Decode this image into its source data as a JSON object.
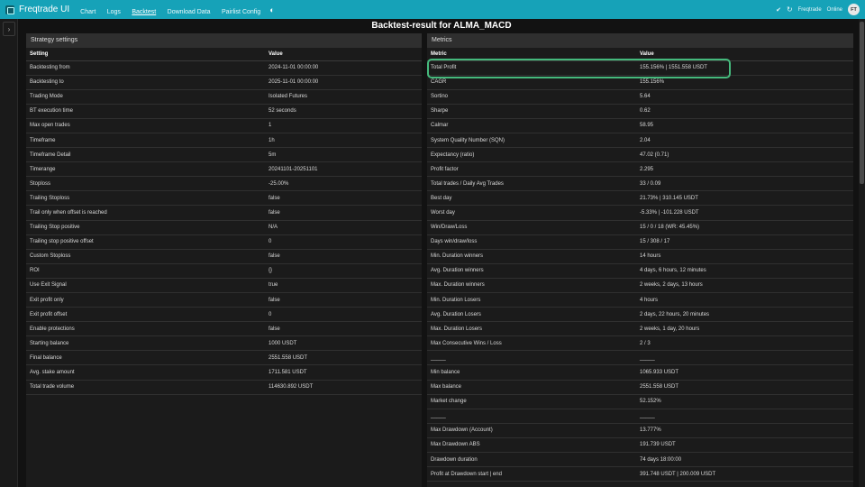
{
  "topbar": {
    "brand": "Freqtrade UI",
    "nav": [
      "Chart",
      "Logs",
      "Backtest",
      "Download Data",
      "Pairlist Config"
    ],
    "active_nav": "Backtest",
    "bot_name": "Freqtrade",
    "status": "Online",
    "avatar": "FT"
  },
  "page": {
    "title": "Backtest-result for ALMA_MACD"
  },
  "strategy": {
    "header": "Strategy settings",
    "col_setting": "Setting",
    "col_value": "Value",
    "rows": [
      [
        "Backtesting from",
        "2024-11-01 00:00:00"
      ],
      [
        "Backtesting to",
        "2025-11-01 00:00:00"
      ],
      [
        "Trading Mode",
        "Isolated Futures"
      ],
      [
        "BT execution time",
        "52 seconds"
      ],
      [
        "Max open trades",
        "1"
      ],
      [
        "Timeframe",
        "1h"
      ],
      [
        "Timeframe Detail",
        "5m"
      ],
      [
        "Timerange",
        "20241101-20251101"
      ],
      [
        "Stoploss",
        "-25.00%"
      ],
      [
        "Trailing Stoploss",
        "false"
      ],
      [
        "Trail only when offset is reached",
        "false"
      ],
      [
        "Trailing Stop positive",
        "N/A"
      ],
      [
        "Trailing stop positive offset",
        "0"
      ],
      [
        "Custom Stoploss",
        "false"
      ],
      [
        "ROI",
        "{}"
      ],
      [
        "Use Exit Signal",
        "true"
      ],
      [
        "Exit profit only",
        "false"
      ],
      [
        "Exit profit offset",
        "0"
      ],
      [
        "Enable protections",
        "false"
      ],
      [
        "Starting balance",
        "1000 USDT"
      ],
      [
        "Final balance",
        "2551.558 USDT"
      ],
      [
        "Avg. stake amount",
        "1711.581 USDT"
      ],
      [
        "Total trade volume",
        "114630.892 USDT"
      ]
    ]
  },
  "metrics": {
    "header": "Metrics",
    "col_metric": "Metric",
    "col_value": "Value",
    "rows": [
      [
        "Total Profit",
        "155.156% | 1551.558 USDT"
      ],
      [
        "CAGR",
        "155.156%"
      ],
      [
        "Sortino",
        "5.64"
      ],
      [
        "Sharpe",
        "0.62"
      ],
      [
        "Calmar",
        "58.95"
      ],
      [
        "System Quality Number (SQN)",
        "2.04"
      ],
      [
        "Expectancy (ratio)",
        "47.02 (0.71)"
      ],
      [
        "Profit factor",
        "2.295"
      ],
      [
        "Total trades / Daily Avg Trades",
        "33 / 0.09"
      ],
      [
        "Best day",
        "21.73% | 310.145 USDT"
      ],
      [
        "Worst day",
        "-5.33% | -101.228 USDT"
      ],
      [
        "Win/Draw/Loss",
        "15 / 0 / 18 (WR: 45.45%)"
      ],
      [
        "Days win/draw/loss",
        "15 / 308 / 17"
      ],
      [
        "Min. Duration winners",
        "14 hours"
      ],
      [
        "Avg. Duration winners",
        "4 days, 6 hours, 12 minutes"
      ],
      [
        "Max. Duration winners",
        "2 weeks, 2 days, 13 hours"
      ],
      [
        "Min. Duration Losers",
        "4 hours"
      ],
      [
        "Avg. Duration Losers",
        "2 days, 22 hours, 20 minutes"
      ],
      [
        "Max. Duration Losers",
        "2 weeks, 1 day, 20 hours"
      ],
      [
        "Max Consecutive Wins / Loss",
        "2 / 3"
      ],
      [
        "_____",
        "_____"
      ],
      [
        "Min balance",
        "1065.933 USDT"
      ],
      [
        "Max balance",
        "2551.558 USDT"
      ],
      [
        "Market change",
        "52.152%"
      ],
      [
        "_____",
        "_____"
      ],
      [
        "Max Drawdown (Account)",
        "13.777%"
      ],
      [
        "Max Drawdown ABS",
        "191.739 USDT"
      ],
      [
        "Drawdown duration",
        "74 days 18:00:00"
      ],
      [
        "Profit at Drawdown start | end",
        "391.748 USDT | 200.009 USDT"
      ]
    ]
  },
  "colors": {
    "accent": "#16a2b8",
    "highlight": "#45b97c",
    "background": "#121212"
  }
}
